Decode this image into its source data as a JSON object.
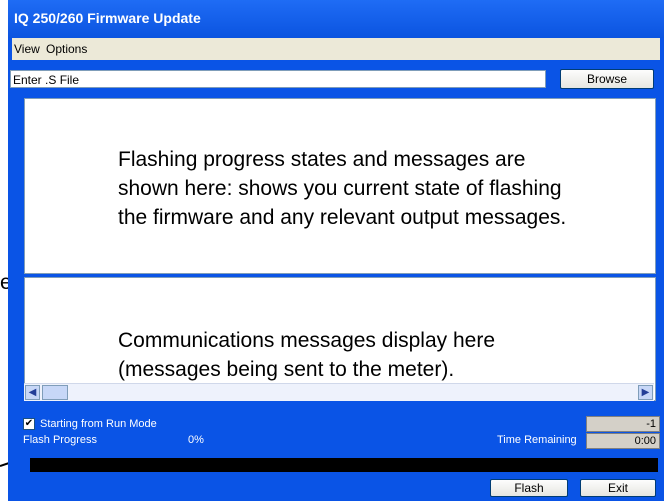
{
  "window": {
    "title": "IQ 250/260 Firmware Update"
  },
  "menu": {
    "items": [
      "View",
      "Options"
    ]
  },
  "file": {
    "input_value": "Enter .S File",
    "browse_label": "Browse"
  },
  "status_pane": {
    "lines": [
      "Flashing progress states and messages are",
      "shown here: shows you current state of flashing",
      "the firmware and any relevant output messages."
    ]
  },
  "comm_pane": {
    "lines": [
      "Communications messages display here",
      "(messages being sent to the meter)."
    ]
  },
  "left_text": "e.",
  "bottom": {
    "checkbox_label": "Starting from Run Mode",
    "checked": true,
    "flash_progress_label": "Flash Progress",
    "flash_progress_percent": "0%",
    "progress_value": 0,
    "time_remaining_label": "Time Remaining",
    "counter_value": "-1",
    "time_value": "0:00",
    "flash_button": "Flash",
    "exit_button": "Exit"
  },
  "icons": {
    "scroll_left": "scroll-left-arrow-icon",
    "scroll_right": "scroll-right-arrow-icon",
    "check": "check-icon",
    "pointer_arrow": "pointer-arrow-icon"
  },
  "colors": {
    "titlebar": "#0b54e0",
    "frame": "#0a54e6",
    "menubar": "#ece9d8"
  }
}
